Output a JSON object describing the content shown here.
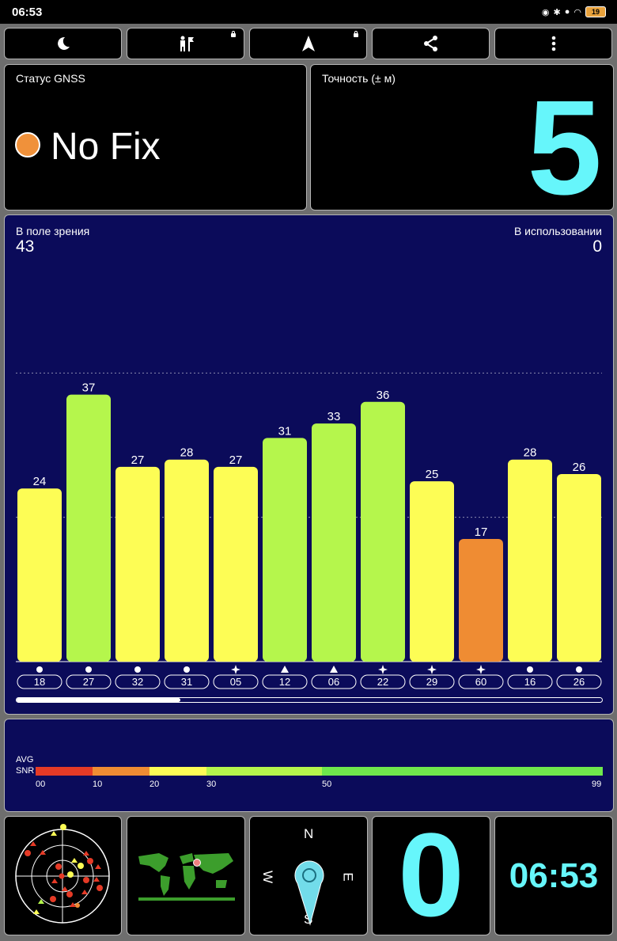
{
  "status_bar": {
    "time": "06:53",
    "battery": "19"
  },
  "gnss_status": {
    "label": "Статус GNSS",
    "value": "No Fix",
    "indicator_color": "#f0913a"
  },
  "accuracy": {
    "label": "Точность (± м)",
    "value": "5"
  },
  "satellites": {
    "in_view_label": "В поле зрения",
    "in_view_count": "43",
    "in_use_label": "В использовании",
    "in_use_count": "0"
  },
  "chart_data": {
    "type": "bar",
    "categories": [
      "18",
      "27",
      "32",
      "31",
      "05",
      "12",
      "06",
      "22",
      "29",
      "60",
      "16",
      "26"
    ],
    "values": [
      24,
      37,
      27,
      28,
      27,
      31,
      33,
      36,
      25,
      17,
      28,
      26
    ],
    "symbols": [
      "circle",
      "circle",
      "circle",
      "circle",
      "star",
      "triangle",
      "triangle",
      "star",
      "star",
      "star",
      "circle",
      "circle"
    ],
    "colors": [
      "#fdfd55",
      "#b5f64c",
      "#fdfd55",
      "#fdfd55",
      "#fdfd55",
      "#b5f64c",
      "#b5f64c",
      "#b5f64c",
      "#fdfd55",
      "#ef8c33",
      "#fdfd55",
      "#fdfd55"
    ],
    "ylim": [
      0,
      60
    ],
    "grid": true,
    "scroll_progress": 0.28
  },
  "snr": {
    "label_line1": "AVG",
    "label_line2": "SNR",
    "ticks": [
      "00",
      "10",
      "20",
      "30",
      "50",
      "99"
    ],
    "segments": [
      {
        "from": 0,
        "to": 10,
        "color": "#e53a26"
      },
      {
        "from": 10,
        "to": 20,
        "color": "#ef8c33"
      },
      {
        "from": 20,
        "to": 30,
        "color": "#fdfd55"
      },
      {
        "from": 30,
        "to": 50,
        "color": "#b5f64c"
      },
      {
        "from": 50,
        "to": 99,
        "color": "#6fe84c"
      }
    ]
  },
  "compass": {
    "n": "N",
    "s": "S",
    "e": "E",
    "w": "W"
  },
  "speed_value": "0",
  "clock": "06:53",
  "toolbar": {
    "night_icon": "moon-icon",
    "person_icon": "person-flag-icon",
    "nav_icon": "navigation-arrow-icon",
    "share_icon": "share-icon",
    "menu_icon": "more-vert-icon"
  }
}
